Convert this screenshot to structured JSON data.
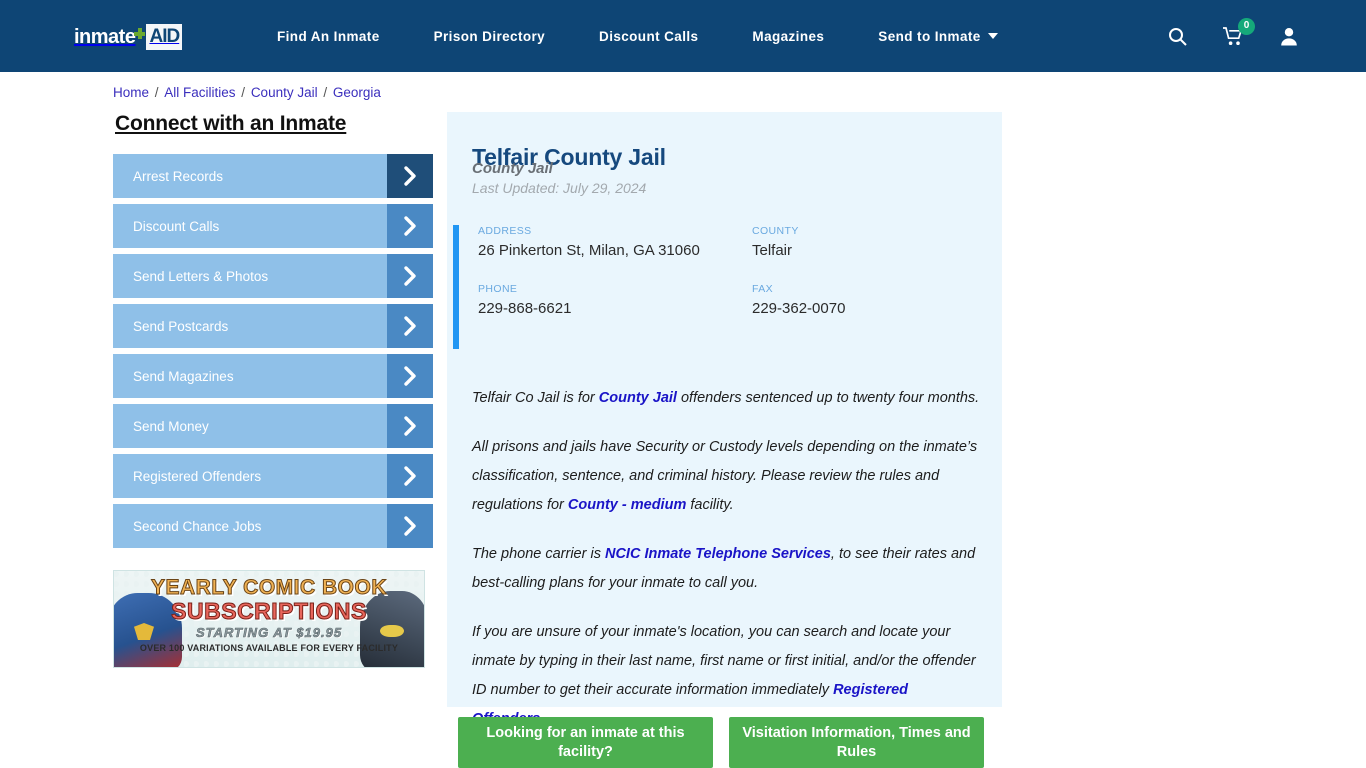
{
  "header": {
    "logo": {
      "word": "inmate",
      "badge": "AID",
      "cross_icon": "green-cross-icon"
    },
    "nav": [
      {
        "label": "Find An Inmate"
      },
      {
        "label": "Prison Directory"
      },
      {
        "label": "Discount Calls"
      },
      {
        "label": "Magazines"
      },
      {
        "label": "Send to Inmate",
        "has_caret": true
      }
    ],
    "icons": {
      "search": "search-icon",
      "cart": "cart-icon",
      "cart_count": "0",
      "account": "user-icon"
    },
    "bg_color": "#0e4575",
    "badge_color": "#15a97a"
  },
  "breadcrumb": {
    "items": [
      "Home",
      "All Facilities",
      "County Jail",
      "Georgia"
    ],
    "separator": "/",
    "link_color": "#3b2fbd"
  },
  "sidebar": {
    "title": "Connect with an Inmate",
    "items": [
      {
        "label": "Arrest Records",
        "active": true
      },
      {
        "label": "Discount Calls",
        "active": false
      },
      {
        "label": "Send Letters & Photos",
        "active": false
      },
      {
        "label": "Send Postcards",
        "active": false
      },
      {
        "label": "Send Magazines",
        "active": false
      },
      {
        "label": "Send Money",
        "active": false
      },
      {
        "label": "Registered Offenders",
        "active": false
      },
      {
        "label": "Second Chance Jobs",
        "active": false
      }
    ],
    "ad": {
      "line1": "YEARLY COMIC BOOK",
      "line2": "SUBSCRIPTIONS",
      "line3": "STARTING AT $19.95",
      "line4": "OVER 100 VARIATIONS AVAILABLE FOR EVERY FACILITY"
    }
  },
  "facility": {
    "name": "Telfair County Jail",
    "type": "County Jail",
    "last_updated": "Last Updated: July 29, 2024",
    "fields": [
      {
        "label": "ADDRESS",
        "value": "26 Pinkerton St, Milan, GA 31060"
      },
      {
        "label": "COUNTY",
        "value": "Telfair"
      },
      {
        "label": "PHONE",
        "value": "229-868-6621"
      },
      {
        "label": "FAX",
        "value": "229-362-0070"
      }
    ],
    "paragraphs": [
      {
        "parts": [
          {
            "t": "Telfair Co Jail is for "
          },
          {
            "t": "County Jail",
            "link": true
          },
          {
            "t": " offenders sentenced up to twenty four months."
          }
        ]
      },
      {
        "parts": [
          {
            "t": "All prisons and jails have Security or Custody levels depending on the inmate’s classification, sentence, and criminal history. Please review the rules and regulations for "
          },
          {
            "t": "County - medium",
            "link": true
          },
          {
            "t": " facility."
          }
        ]
      },
      {
        "parts": [
          {
            "t": "The phone carrier is "
          },
          {
            "t": "NCIC Inmate Telephone Services",
            "link": true
          },
          {
            "t": ", to see their rates and best-calling plans for your inmate to call you."
          }
        ]
      },
      {
        "parts": [
          {
            "t": "If you are unsure of your inmate's location, you can search and locate your inmate by typing in their last name, first name or first initial, and/or the offender ID number to get their accurate information immediately "
          },
          {
            "t": "Registered Offenders",
            "link": true
          }
        ]
      }
    ]
  },
  "cta_buttons": [
    {
      "label": "Looking for an inmate at this facility?"
    },
    {
      "label": "Visitation Information, Times and Rules"
    }
  ],
  "colors": {
    "header_blue": "#0e4575",
    "card_blue": "#eaf6fd",
    "accent_blue": "#2196f3",
    "sidebar_btn": "#8fc0e8",
    "sidebar_arrow": "#4a89c4",
    "sidebar_arrow_active": "#1f4e79",
    "cta_green": "#4caf50",
    "link_blue": "#1a14c7"
  }
}
